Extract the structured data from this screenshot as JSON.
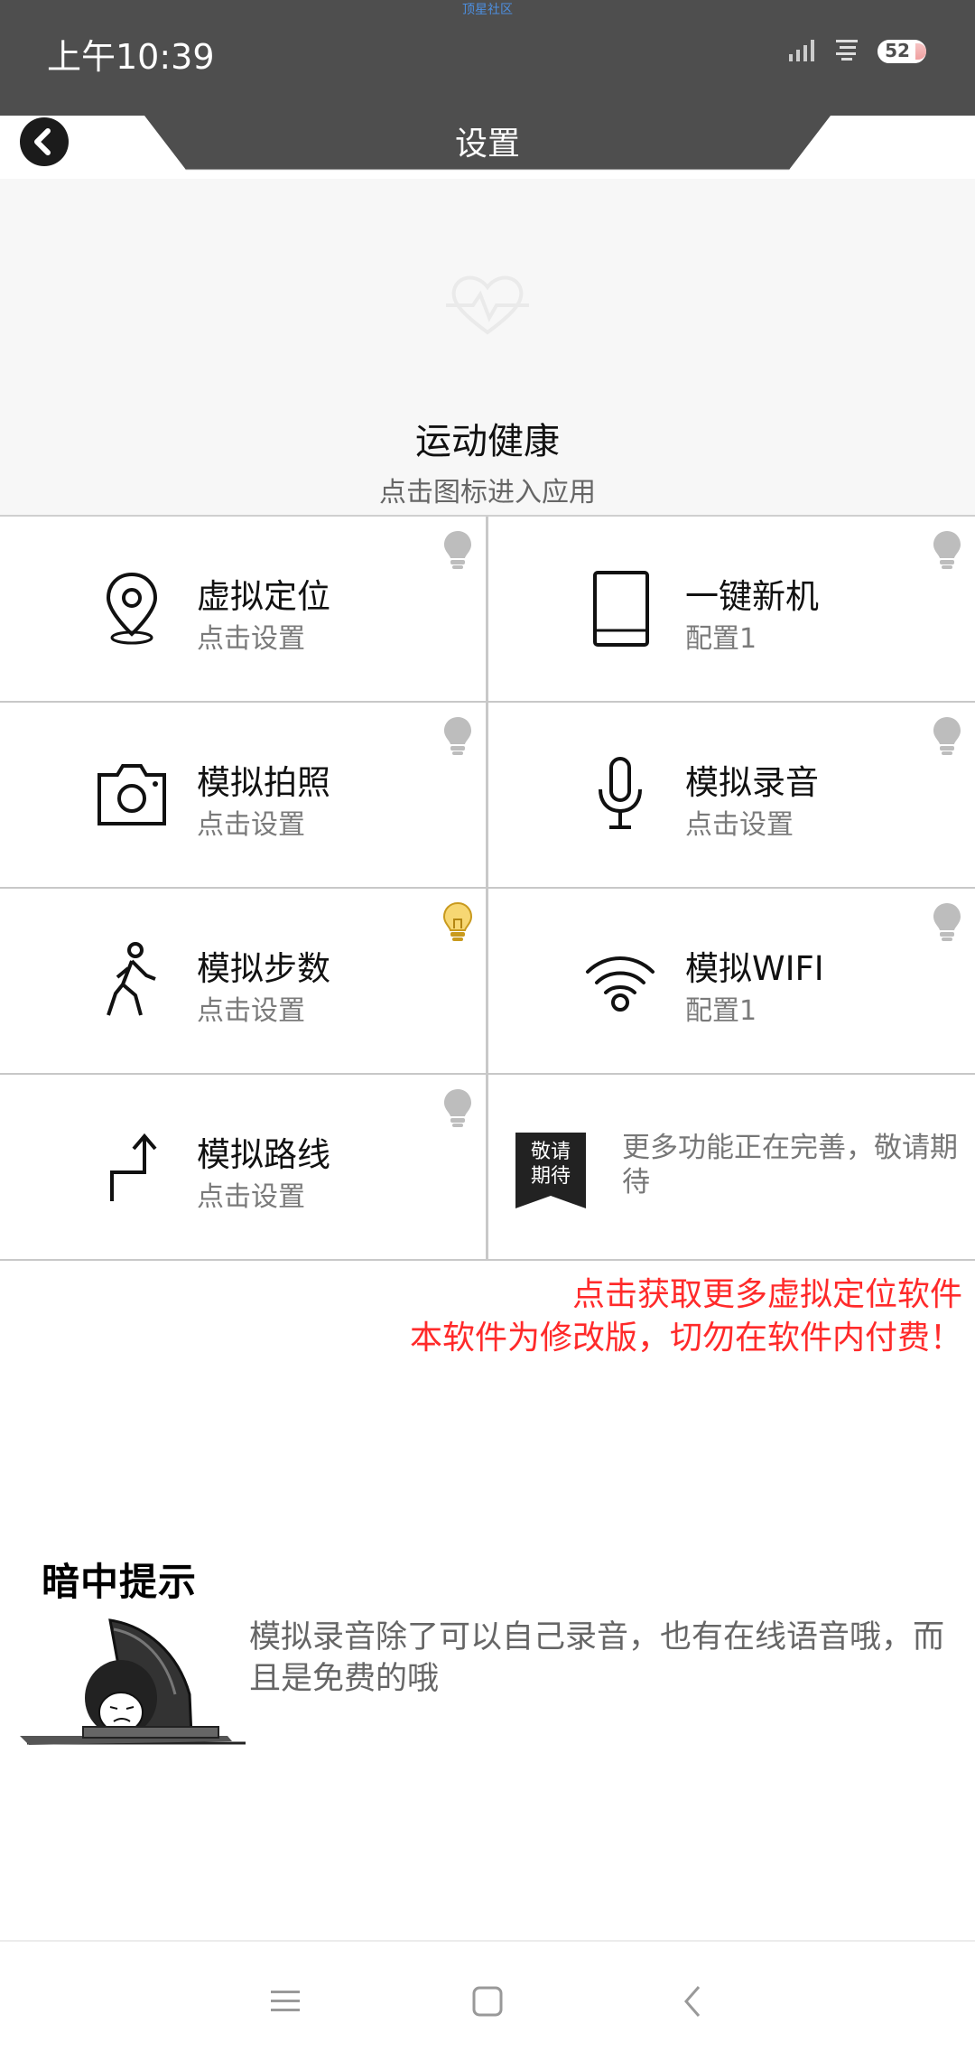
{
  "status_bar": {
    "tiny_label": "顶星社区",
    "time": "上午10:39",
    "battery": "52"
  },
  "header": {
    "title": "设置"
  },
  "hero": {
    "app_name": "运动健康",
    "hint": "点击图标进入应用"
  },
  "features": [
    {
      "name": "虚拟定位",
      "sub": "点击设置",
      "icon": "location-pin-icon"
    },
    {
      "name": "一键新机",
      "sub": "配置1",
      "icon": "tablet-icon"
    },
    {
      "name": "模拟拍照",
      "sub": "点击设置",
      "icon": "camera-icon"
    },
    {
      "name": "模拟录音",
      "sub": "点击设置",
      "icon": "microphone-icon"
    },
    {
      "name": "模拟步数",
      "sub": "点击设置",
      "icon": "walking-person-icon"
    },
    {
      "name": "模拟WIFI",
      "sub": "配置1",
      "icon": "wifi-icon"
    },
    {
      "name": "模拟路线",
      "sub": "点击设置",
      "icon": "route-arrow-icon"
    }
  ],
  "coming_soon": {
    "tag_line1": "敬请",
    "tag_line2": "期待",
    "text": "更多功能正在完善，敬请期待"
  },
  "notice": {
    "line1": "点击获取更多虚拟定位软件",
    "line2": "本软件为修改版，切勿在软件内付费！",
    "color": "#ff2a2a"
  },
  "tip": {
    "title": "暗中提示",
    "text": "模拟录音除了可以自己录音，也有在线语音哦，而且是免费的哦"
  },
  "colors": {
    "status_bar_bg": "#4e4e4e",
    "bulb_on": "#f3c94a",
    "bulb_off": "#bdbdbd"
  }
}
